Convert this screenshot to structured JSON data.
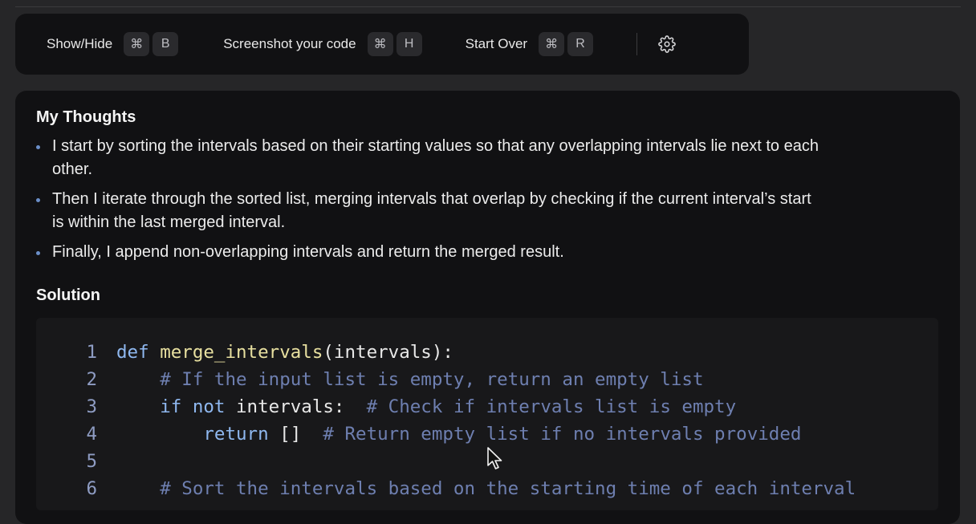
{
  "toolbar": {
    "items": [
      {
        "label": "Show/Hide",
        "keys": [
          "⌘",
          "B"
        ]
      },
      {
        "label": "Screenshot your code",
        "keys": [
          "⌘",
          "H"
        ]
      },
      {
        "label": "Start Over",
        "keys": [
          "⌘",
          "R"
        ]
      }
    ],
    "settings_icon": "gear-icon"
  },
  "thoughts": {
    "title": "My Thoughts",
    "bullets": [
      "I start by sorting the intervals based on their starting values so that any overlapping intervals lie next to each other.",
      "Then I iterate through the sorted list, merging intervals that overlap by checking if the current interval’s start is within the last merged interval.",
      "Finally, I append non-overlapping intervals and return the merged result."
    ]
  },
  "solution": {
    "title": "Solution",
    "lines": [
      {
        "num": "1",
        "indent": "",
        "tokens": [
          {
            "t": "def ",
            "c": "kw"
          },
          {
            "t": "merge_intervals",
            "c": "fn"
          },
          {
            "t": "(intervals):",
            "c": "plain"
          }
        ]
      },
      {
        "num": "2",
        "indent": "    ",
        "tokens": [
          {
            "t": "# If the input list is empty, return an empty list",
            "c": "cm"
          }
        ]
      },
      {
        "num": "3",
        "indent": "    ",
        "tokens": [
          {
            "t": "if not ",
            "c": "kw"
          },
          {
            "t": "intervals:  ",
            "c": "plain"
          },
          {
            "t": "# Check if intervals list is empty",
            "c": "cm"
          }
        ]
      },
      {
        "num": "4",
        "indent": "        ",
        "tokens": [
          {
            "t": "return ",
            "c": "kw"
          },
          {
            "t": "[]  ",
            "c": "plain"
          },
          {
            "t": "# Return empty list if no intervals provided",
            "c": "cm"
          }
        ]
      },
      {
        "num": "5",
        "indent": "",
        "tokens": []
      },
      {
        "num": "6",
        "indent": "    ",
        "tokens": [
          {
            "t": "# Sort the intervals based on the starting time of each interval",
            "c": "cm"
          }
        ]
      }
    ]
  },
  "colors": {
    "keyword": "#8fb8f0",
    "function": "#e8e0a0",
    "comment": "#6e7fb0",
    "bullet": "#6b8fc9"
  }
}
